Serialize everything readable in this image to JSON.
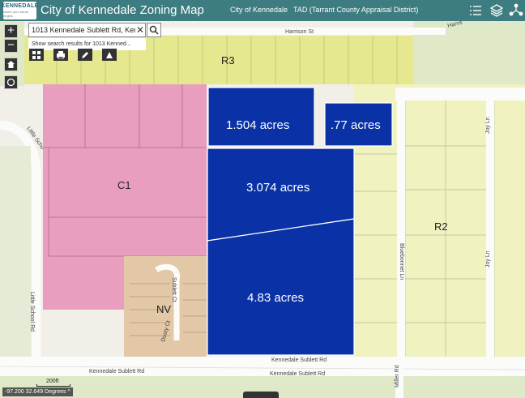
{
  "header": {
    "logo_text": "KENNEDALE",
    "logo_sub": "where your future begins",
    "title": "City of Kennedale Zoning Map",
    "links": [
      {
        "label": "City of Kennedale"
      },
      {
        "label": "TAD (Tarrant County Appraisal District)"
      }
    ],
    "icons": [
      "legend-list-icon",
      "layers-icon",
      "share-icon"
    ]
  },
  "search": {
    "value": "1013 Kennedale Sublett Rd, Ken",
    "suggestion": "Show search results for 1013 Kenned..."
  },
  "map_controls": [
    "zoom-in-icon",
    "zoom-out-icon",
    "home-icon",
    "locate-icon"
  ],
  "parcels": [
    {
      "label": "1.504 acres"
    },
    {
      "label": ".77 acres"
    },
    {
      "label": "3.074 acres"
    },
    {
      "label": "4.83 acres"
    }
  ],
  "zones": [
    "R3",
    "C1",
    "R2",
    "NV"
  ],
  "roads": {
    "harrison_top": "Harrison St",
    "harrison_right": "Harris",
    "little_school_upper": "Little Scho",
    "little_school_lower": "Little School Rd",
    "sublett_upper": "Kennedale Sublett Rd",
    "sublett_lower": "Kennedale Sublett Rd",
    "bluebonnet": "Bluebonnet Ln",
    "joy_upper": "Joy Ln",
    "joy_lower": "Joy Ln",
    "sublett_ct": "Sublett Ct",
    "dusty_ct": "Dusty Ct",
    "miller_rd": "Miller Rd"
  },
  "coordinates": "-97.200 32.649 Degrees",
  "scale": "200ft",
  "colors": {
    "header": "#3d7c80",
    "parcel_selected": "#0a31a6",
    "zone_r3": "#e6e88f",
    "zone_r2": "#f0f2bf",
    "zone_c1": "#e99ec0",
    "zone_nv": "#e3c8a8"
  }
}
